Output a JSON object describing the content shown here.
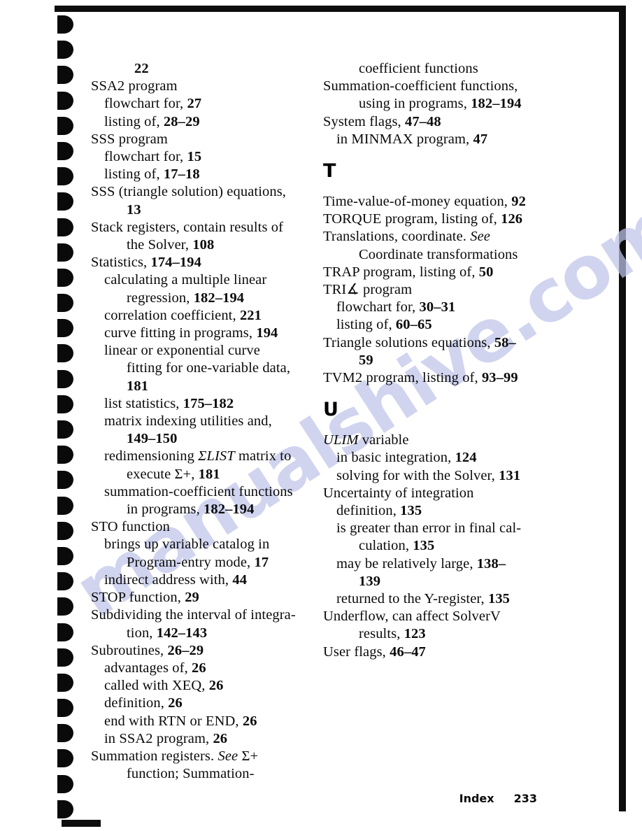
{
  "page": {
    "footer_label": "Index",
    "footer_page_number": "233",
    "watermark_text": "manualshive.com",
    "binding_hole_count": 32
  },
  "columns": [
    {
      "name": "left-column",
      "entries": [
        {
          "level": 3,
          "parts": [
            {
              "t": "22",
              "s": "b"
            }
          ]
        },
        {
          "level": 0,
          "parts": [
            {
              "t": "SSA2 program",
              "s": "n"
            }
          ]
        },
        {
          "level": 1,
          "parts": [
            {
              "t": "flowchart for, ",
              "s": "n"
            },
            {
              "t": "27",
              "s": "b"
            }
          ]
        },
        {
          "level": 1,
          "parts": [
            {
              "t": "listing of, ",
              "s": "n"
            },
            {
              "t": "28–29",
              "s": "b"
            }
          ]
        },
        {
          "level": 0,
          "parts": [
            {
              "t": "SSS program",
              "s": "n"
            }
          ]
        },
        {
          "level": 1,
          "parts": [
            {
              "t": "flowchart for, ",
              "s": "n"
            },
            {
              "t": "15",
              "s": "b"
            }
          ]
        },
        {
          "level": 1,
          "parts": [
            {
              "t": "listing of, ",
              "s": "n"
            },
            {
              "t": "17–18",
              "s": "b"
            }
          ]
        },
        {
          "level": 0,
          "parts": [
            {
              "t": "SSS (triangle solution) equations,",
              "s": "n"
            }
          ]
        },
        {
          "level": 2,
          "parts": [
            {
              "t": "13",
              "s": "b"
            }
          ]
        },
        {
          "level": 0,
          "parts": [
            {
              "t": "Stack registers, contain results of",
              "s": "n"
            }
          ]
        },
        {
          "level": 2,
          "parts": [
            {
              "t": "the Solver, ",
              "s": "n"
            },
            {
              "t": "108",
              "s": "b"
            }
          ]
        },
        {
          "level": 0,
          "parts": [
            {
              "t": "Statistics, ",
              "s": "n"
            },
            {
              "t": "174–194",
              "s": "b"
            }
          ]
        },
        {
          "level": 1,
          "parts": [
            {
              "t": "calculating a multiple linear",
              "s": "n"
            }
          ]
        },
        {
          "level": 2,
          "parts": [
            {
              "t": "regression, ",
              "s": "n"
            },
            {
              "t": "182–194",
              "s": "b"
            }
          ]
        },
        {
          "level": 1,
          "parts": [
            {
              "t": "correlation coefficient, ",
              "s": "n"
            },
            {
              "t": "221",
              "s": "b"
            }
          ]
        },
        {
          "level": 1,
          "parts": [
            {
              "t": "curve fitting in programs, ",
              "s": "n"
            },
            {
              "t": "194",
              "s": "b"
            }
          ]
        },
        {
          "level": 1,
          "parts": [
            {
              "t": "linear or exponential curve",
              "s": "n"
            }
          ]
        },
        {
          "level": 2,
          "parts": [
            {
              "t": "fitting for one-variable data,",
              "s": "n"
            }
          ]
        },
        {
          "level": 2,
          "parts": [
            {
              "t": "181",
              "s": "b"
            }
          ]
        },
        {
          "level": 1,
          "parts": [
            {
              "t": "list statistics, ",
              "s": "n"
            },
            {
              "t": "175–182",
              "s": "b"
            }
          ]
        },
        {
          "level": 1,
          "parts": [
            {
              "t": "matrix indexing utilities and,",
              "s": "n"
            }
          ]
        },
        {
          "level": 2,
          "parts": [
            {
              "t": "149–150",
              "s": "b"
            }
          ]
        },
        {
          "level": 1,
          "parts": [
            {
              "t": "redimensioning ",
              "s": "n"
            },
            {
              "t": "ΣLIST",
              "s": "i"
            },
            {
              "t": " matrix to",
              "s": "n"
            }
          ]
        },
        {
          "level": 2,
          "parts": [
            {
              "t": "execute Σ+, ",
              "s": "n"
            },
            {
              "t": "181",
              "s": "b"
            }
          ]
        },
        {
          "level": 1,
          "parts": [
            {
              "t": "summation-coefficient functions",
              "s": "n"
            }
          ]
        },
        {
          "level": 2,
          "parts": [
            {
              "t": "in programs, ",
              "s": "n"
            },
            {
              "t": "182–194",
              "s": "b"
            }
          ]
        },
        {
          "level": 0,
          "parts": [
            {
              "t": "STO function",
              "s": "n"
            }
          ]
        },
        {
          "level": 1,
          "parts": [
            {
              "t": "brings up variable catalog in",
              "s": "n"
            }
          ]
        },
        {
          "level": 2,
          "parts": [
            {
              "t": "Program-entry mode, ",
              "s": "n"
            },
            {
              "t": "17",
              "s": "b"
            }
          ]
        },
        {
          "level": 1,
          "parts": [
            {
              "t": "indirect address with, ",
              "s": "n"
            },
            {
              "t": "44",
              "s": "b"
            }
          ]
        },
        {
          "level": 0,
          "parts": [
            {
              "t": "STOP function, ",
              "s": "n"
            },
            {
              "t": "29",
              "s": "b"
            }
          ]
        },
        {
          "level": 0,
          "parts": [
            {
              "t": "Subdividing the interval of integra-",
              "s": "n"
            }
          ]
        },
        {
          "level": 2,
          "parts": [
            {
              "t": "tion, ",
              "s": "n"
            },
            {
              "t": "142–143",
              "s": "b"
            }
          ]
        },
        {
          "level": 0,
          "parts": [
            {
              "t": "Subroutines, ",
              "s": "n"
            },
            {
              "t": "26–29",
              "s": "b"
            }
          ]
        },
        {
          "level": 1,
          "parts": [
            {
              "t": "advantages of, ",
              "s": "n"
            },
            {
              "t": "26",
              "s": "b"
            }
          ]
        },
        {
          "level": 1,
          "parts": [
            {
              "t": "called with XEQ, ",
              "s": "n"
            },
            {
              "t": "26",
              "s": "b"
            }
          ]
        },
        {
          "level": 1,
          "parts": [
            {
              "t": "definition, ",
              "s": "n"
            },
            {
              "t": "26",
              "s": "b"
            }
          ]
        },
        {
          "level": 1,
          "parts": [
            {
              "t": "end with RTN or END, ",
              "s": "n"
            },
            {
              "t": "26",
              "s": "b"
            }
          ]
        },
        {
          "level": 1,
          "parts": [
            {
              "t": "in SSA2 program, ",
              "s": "n"
            },
            {
              "t": "26",
              "s": "b"
            }
          ]
        },
        {
          "level": 0,
          "parts": [
            {
              "t": "Summation registers. ",
              "s": "n"
            },
            {
              "t": "See",
              "s": "i"
            },
            {
              "t": " Σ+",
              "s": "n"
            }
          ]
        },
        {
          "level": 2,
          "parts": [
            {
              "t": "function; Summation-",
              "s": "n"
            }
          ]
        }
      ]
    },
    {
      "name": "right-column",
      "entries": [
        {
          "level": 2,
          "parts": [
            {
              "t": "coefficient functions",
              "s": "n"
            }
          ]
        },
        {
          "level": 0,
          "parts": [
            {
              "t": "Summation-coefficient functions,",
              "s": "n"
            }
          ]
        },
        {
          "level": 2,
          "parts": [
            {
              "t": "using in programs, ",
              "s": "n"
            },
            {
              "t": "182–194",
              "s": "b"
            }
          ]
        },
        {
          "level": 0,
          "parts": [
            {
              "t": "System flags, ",
              "s": "n"
            },
            {
              "t": "47–48",
              "s": "b"
            }
          ]
        },
        {
          "level": 1,
          "parts": [
            {
              "t": "in MINMAX program, ",
              "s": "n"
            },
            {
              "t": "47",
              "s": "b"
            }
          ]
        },
        {
          "heading": "T"
        },
        {
          "level": 0,
          "parts": [
            {
              "t": "Time-value-of-money equation, ",
              "s": "n"
            },
            {
              "t": "92",
              "s": "b"
            }
          ]
        },
        {
          "level": 0,
          "parts": [
            {
              "t": "TORQUE program, listing of, ",
              "s": "n"
            },
            {
              "t": "126",
              "s": "b"
            }
          ]
        },
        {
          "level": 0,
          "parts": [
            {
              "t": "Translations, coordinate. ",
              "s": "n"
            },
            {
              "t": "See",
              "s": "i"
            }
          ]
        },
        {
          "level": 2,
          "parts": [
            {
              "t": "Coordinate transformations",
              "s": "n"
            }
          ]
        },
        {
          "level": 0,
          "parts": [
            {
              "t": "TRAP program, listing of, ",
              "s": "n"
            },
            {
              "t": "50",
              "s": "b"
            }
          ]
        },
        {
          "level": 0,
          "parts": [
            {
              "t": "TRI∡ program",
              "s": "n"
            }
          ]
        },
        {
          "level": 1,
          "parts": [
            {
              "t": "flowchart for, ",
              "s": "n"
            },
            {
              "t": "30–31",
              "s": "b"
            }
          ]
        },
        {
          "level": 1,
          "parts": [
            {
              "t": "listing of, ",
              "s": "n"
            },
            {
              "t": "60–65",
              "s": "b"
            }
          ]
        },
        {
          "level": 0,
          "parts": [
            {
              "t": "Triangle solutions equations, ",
              "s": "n"
            },
            {
              "t": "58–",
              "s": "b"
            }
          ]
        },
        {
          "level": 2,
          "parts": [
            {
              "t": "59",
              "s": "b"
            }
          ]
        },
        {
          "level": 0,
          "parts": [
            {
              "t": "TVM2 program, listing of, ",
              "s": "n"
            },
            {
              "t": "93–99",
              "s": "b"
            }
          ]
        },
        {
          "heading": "U"
        },
        {
          "level": 0,
          "parts": [
            {
              "t": "ULIM",
              "s": "i"
            },
            {
              "t": " variable",
              "s": "n"
            }
          ]
        },
        {
          "level": 1,
          "parts": [
            {
              "t": "in basic integration, ",
              "s": "n"
            },
            {
              "t": "124",
              "s": "b"
            }
          ]
        },
        {
          "level": 1,
          "parts": [
            {
              "t": "solving for with the Solver, ",
              "s": "n"
            },
            {
              "t": "131",
              "s": "b"
            }
          ]
        },
        {
          "level": 0,
          "parts": [
            {
              "t": "Uncertainty of integration",
              "s": "n"
            }
          ]
        },
        {
          "level": 1,
          "parts": [
            {
              "t": "definition, ",
              "s": "n"
            },
            {
              "t": "135",
              "s": "b"
            }
          ]
        },
        {
          "level": 1,
          "parts": [
            {
              "t": "is greater than error in final cal-",
              "s": "n"
            }
          ]
        },
        {
          "level": 2,
          "parts": [
            {
              "t": "culation, ",
              "s": "n"
            },
            {
              "t": "135",
              "s": "b"
            }
          ]
        },
        {
          "level": 1,
          "parts": [
            {
              "t": "may be relatively large, ",
              "s": "n"
            },
            {
              "t": "138–",
              "s": "b"
            }
          ]
        },
        {
          "level": 2,
          "parts": [
            {
              "t": "139",
              "s": "b"
            }
          ]
        },
        {
          "level": 1,
          "parts": [
            {
              "t": "returned to the Y-register, ",
              "s": "n"
            },
            {
              "t": "135",
              "s": "b"
            }
          ]
        },
        {
          "level": 0,
          "parts": [
            {
              "t": "Underflow, can affect SolverV",
              "s": "n"
            }
          ]
        },
        {
          "level": 2,
          "parts": [
            {
              "t": "results, ",
              "s": "n"
            },
            {
              "t": "123",
              "s": "b"
            }
          ]
        },
        {
          "level": 0,
          "parts": [
            {
              "t": "User flags, ",
              "s": "n"
            },
            {
              "t": "46–47",
              "s": "b"
            }
          ]
        }
      ]
    }
  ]
}
